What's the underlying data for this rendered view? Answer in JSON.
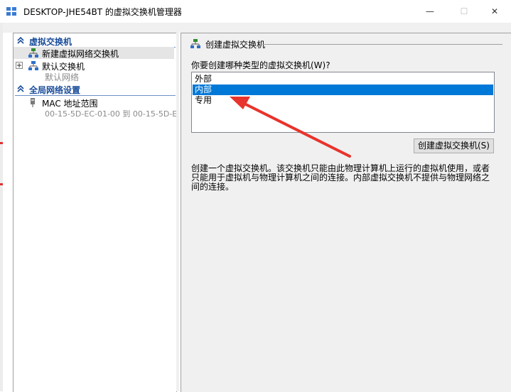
{
  "window": {
    "title": "DESKTOP-JHE54BT 的虚拟交换机管理器",
    "minimize_glyph": "—",
    "maximize_glyph": "☐",
    "close_glyph": "✕"
  },
  "sidebar": {
    "section_virtual_switches": "虚拟交换机",
    "new_switch": "新建虚拟网络交换机",
    "default_switch": "默认交换机",
    "default_switch_sub": "默认网络",
    "section_global": "全局网络设置",
    "mac_range": "MAC 地址范围",
    "mac_range_value": "00-15-5D-EC-01-00 到 00-15-5D-E..."
  },
  "panel": {
    "header": "创建虚拟交换机",
    "question": "你要创建哪种类型的虚拟交换机(W)?",
    "types": [
      "外部",
      "内部",
      "专用"
    ],
    "selected_type": "内部",
    "create_button": "创建虚拟交换机(S)",
    "description": "创建一个虚拟交换机。该交换机只能由此物理计算机上运行的虚拟机使用，或者只能用于虚拟机与物理计算机之间的连接。内部虚拟交换机不提供与物理网络之间的连接。"
  },
  "colors": {
    "accent_blue": "#0078d7",
    "section_blue": "#1a4c9a",
    "annotation_red": "#e8342c"
  },
  "icons": [
    "network-switch-icon",
    "chevron-up-icon",
    "expand-plus-icon",
    "network-adapter-icon"
  ]
}
